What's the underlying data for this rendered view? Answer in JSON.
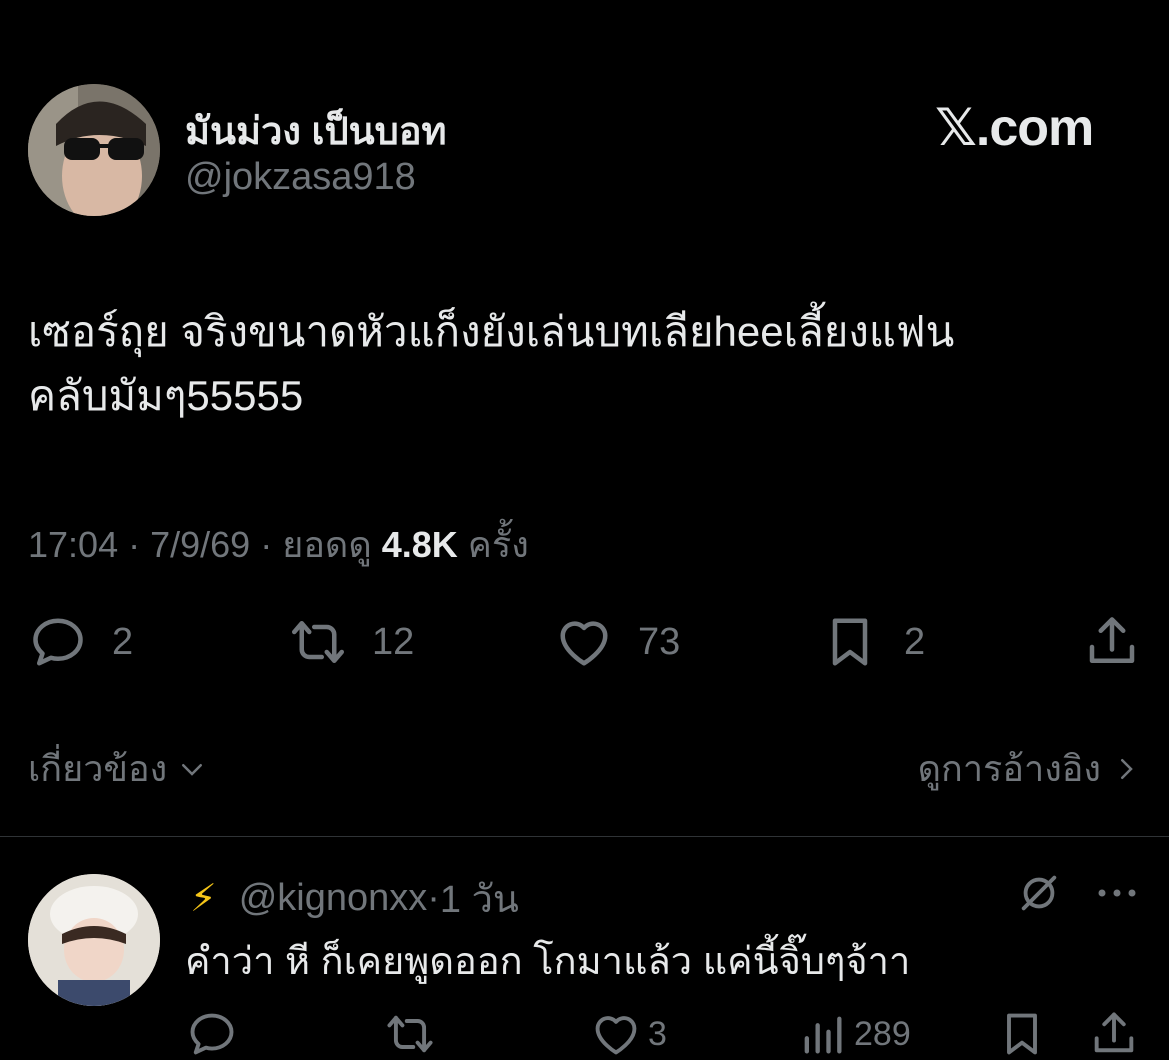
{
  "tweet": {
    "display_name": "มันม่วง เป็นบอท",
    "handle": "@jokzasa918",
    "brand": "𝕏.com",
    "text_line1": "เซอร์ถุย จริงขนาดหัวแก็งยังเล่นบทเลียheeเลี้ยงแฟน",
    "text_line2": "คลับมัมๆ55555",
    "time": "17:04",
    "date": "7/9/69",
    "views_label": "ยอดดู",
    "views_count": "4.8K",
    "views_suffix": "ครั้ง",
    "replies": "2",
    "retweets": "12",
    "likes": "73",
    "bookmarks": "2"
  },
  "footer": {
    "related_label": "เกี่ยวข้อง",
    "quotes_label": "ดูการอ้างอิง"
  },
  "reply": {
    "emoji": "⚡",
    "handle": "@kignonxx",
    "time": "1 วัน",
    "text": "คำว่า หี ก็เคยพูดออก โกมาแล้ว แค่นี้จิ๊บๆจ้าา",
    "likes": "3",
    "views": "289"
  },
  "colors": {
    "background": "#000000",
    "text_primary": "#e7e9ea",
    "text_secondary": "#71767b",
    "divider": "#2f3336"
  }
}
